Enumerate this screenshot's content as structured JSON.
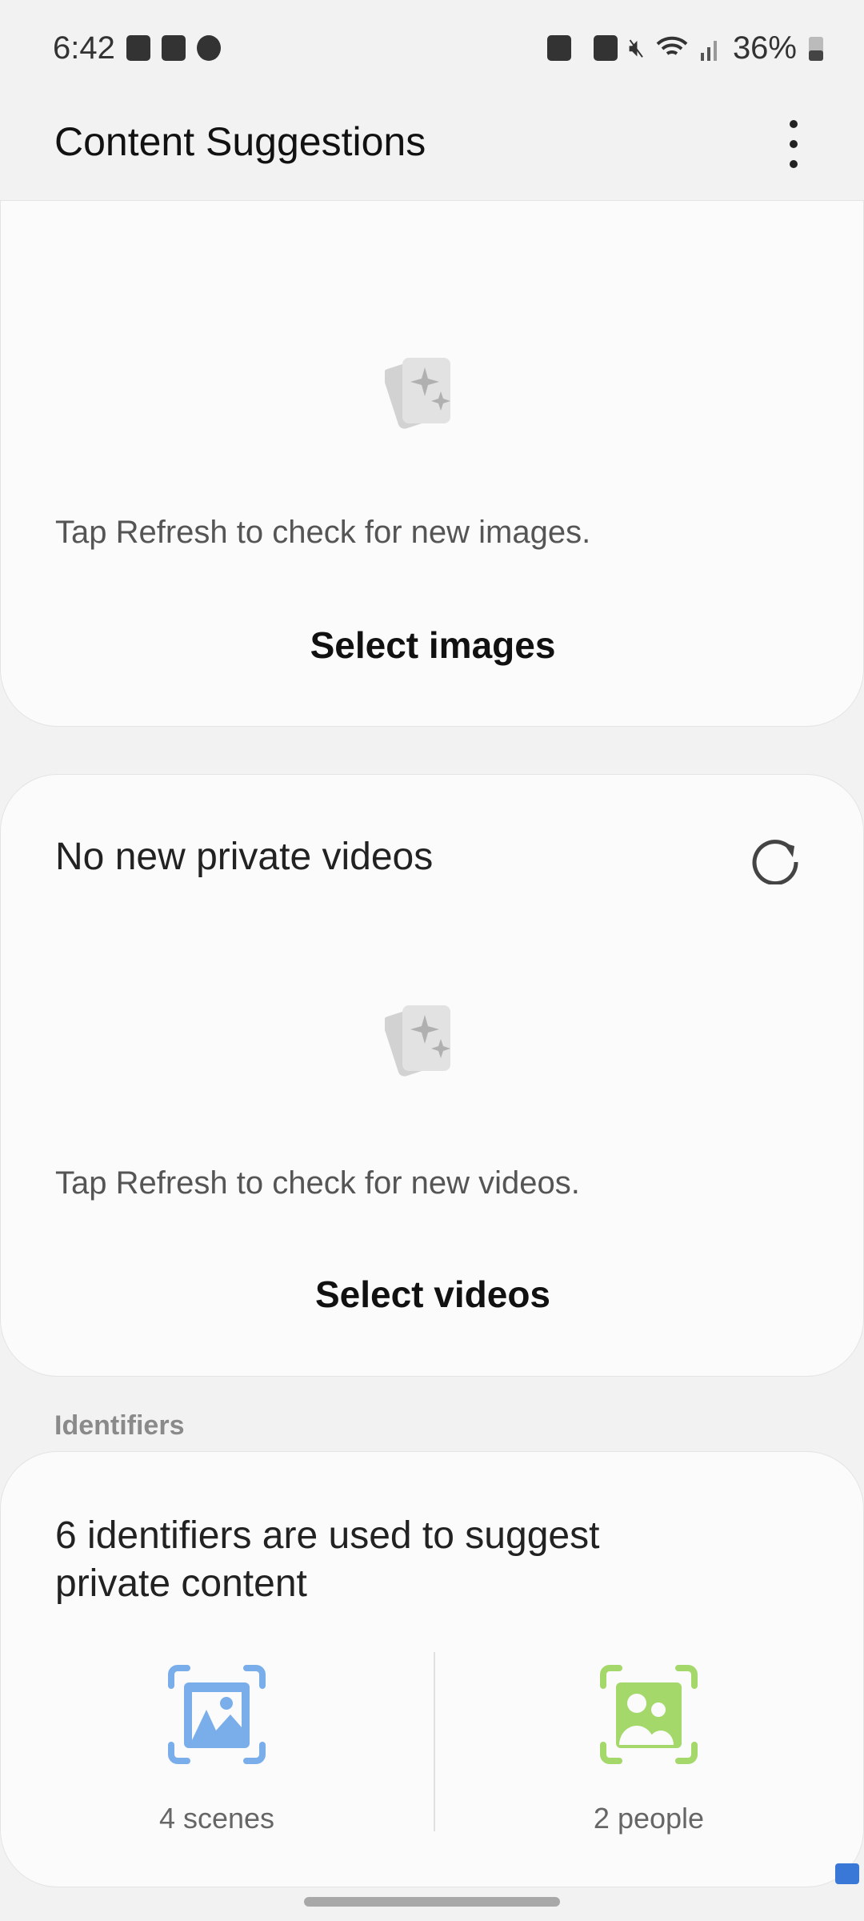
{
  "status_bar": {
    "time": "6:42",
    "battery": "36%",
    "left_icons": [
      "gallery-icon",
      "gallery-icon",
      "do-not-disturb-icon"
    ],
    "right_icons": [
      "secure-folder-icon",
      "work-profile-icon",
      "mute-icon",
      "wifi-icon",
      "signal-icon",
      "battery-icon"
    ]
  },
  "header": {
    "title": "Content Suggestions",
    "menu_icon": "more-vert-icon"
  },
  "images_card": {
    "hint": "Tap Refresh to check for new images.",
    "action": "Select images"
  },
  "videos_card": {
    "title": "No new private videos",
    "hint": "Tap Refresh to check for new videos.",
    "action": "Select videos"
  },
  "identifiers": {
    "section_label": "Identifiers",
    "title": "6 identifiers are used to suggest private content",
    "items": [
      {
        "label": "4 scenes",
        "color": "#7aaeea",
        "icon": "scene-icon"
      },
      {
        "label": "2 people",
        "color": "#a4d86a",
        "icon": "people-icon"
      }
    ]
  }
}
